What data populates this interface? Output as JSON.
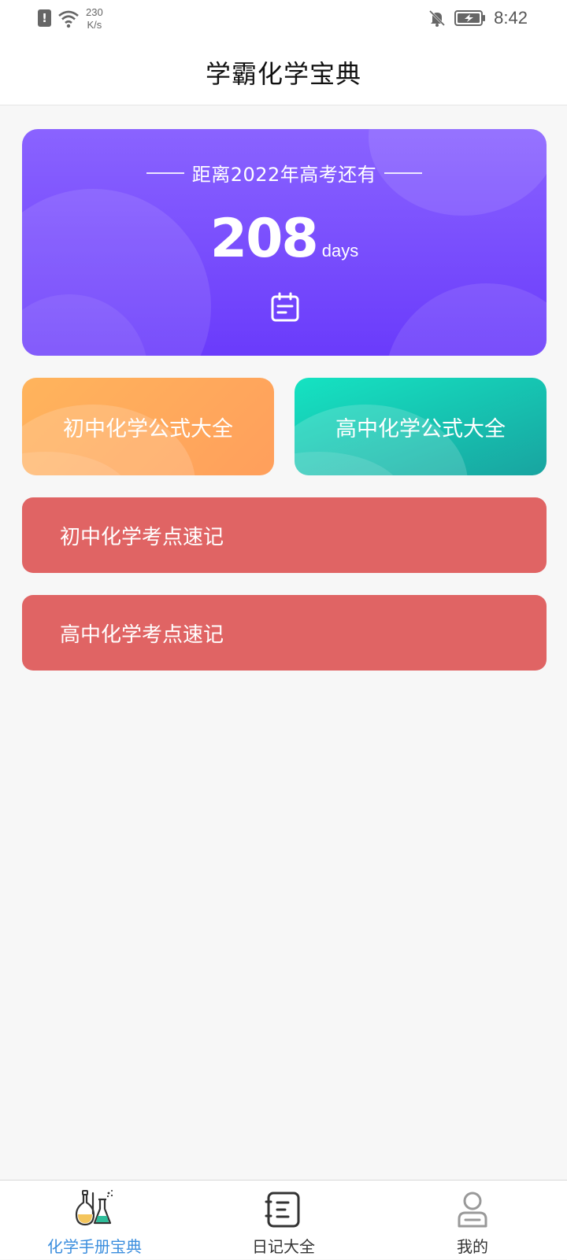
{
  "status_bar": {
    "net_speed_value": "230",
    "net_speed_unit": "K/s",
    "time": "8:42",
    "icons": [
      "sim-alert-icon",
      "wifi-icon",
      "bell-off-icon",
      "battery-charging-icon"
    ]
  },
  "header": {
    "title": "学霸化学宝典"
  },
  "countdown": {
    "label": "距离2022年高考还有",
    "days": "208",
    "unit": "days",
    "icon": "calendar-icon",
    "colors": {
      "top": "#8a63ff",
      "bottom": "#6a3bfb"
    }
  },
  "formula_cards": [
    {
      "label": "初中化学公式大全",
      "color": "#ffa85c"
    },
    {
      "label": "高中化学公式大全",
      "color": "#15c9b6"
    }
  ],
  "memo_cards": [
    {
      "label": "初中化学考点速记",
      "color": "#e06464"
    },
    {
      "label": "高中化学考点速记",
      "color": "#e06464"
    }
  ],
  "tab_bar": {
    "active_color": "#3b8ede",
    "tabs": [
      {
        "label": "化学手册宝典",
        "icon": "flask-icon",
        "active": true
      },
      {
        "label": "日记大全",
        "icon": "notebook-icon",
        "active": false
      },
      {
        "label": "我的",
        "icon": "user-icon",
        "active": false
      }
    ]
  }
}
